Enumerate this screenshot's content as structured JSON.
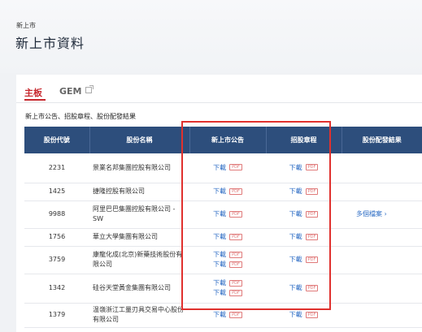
{
  "breadcrumb": "新上市",
  "page_title": "新上市資料",
  "tabs": [
    {
      "label": "主板",
      "active": true
    },
    {
      "label": "GEM",
      "active": false
    }
  ],
  "subtitle": "新上市公告、招股章程、股份配發結果",
  "table": {
    "headers": [
      "股份代號",
      "股份名稱",
      "新上市公告",
      "招股章程",
      "股份配發結果"
    ],
    "download_label": "下載",
    "pdf_label": "PDF",
    "rows": [
      {
        "code": "2231",
        "name": "景業名邦集團控股有限公司",
        "announcement_files": 1,
        "prospectus_files": 1,
        "allotment": ""
      },
      {
        "code": "1425",
        "name": "捷隆控股有限公司",
        "announcement_files": 1,
        "prospectus_files": 1,
        "allotment": ""
      },
      {
        "code": "9988",
        "name": "阿里巴巴集團控股有限公司 - SW",
        "announcement_files": 1,
        "prospectus_files": 1,
        "allotment": "多個檔案 ›"
      },
      {
        "code": "1756",
        "name": "華立大學集團有限公司",
        "announcement_files": 1,
        "prospectus_files": 1,
        "allotment": ""
      },
      {
        "code": "3759",
        "name": "康龍化成(北京)新藥技術股份有限公司",
        "announcement_files": 2,
        "prospectus_files": 1,
        "allotment": ""
      },
      {
        "code": "1342",
        "name": "硅谷天堂黃金集團有限公司",
        "announcement_files": 2,
        "prospectus_files": 1,
        "allotment": ""
      },
      {
        "code": "1379",
        "name": "温嶺浙江工量刃具交易中心股份有限公司",
        "announcement_files": 1,
        "prospectus_files": 1,
        "allotment": ""
      }
    ]
  },
  "colors": {
    "header_bg": "#2d4e7c",
    "accent_red": "#c7282e",
    "highlight_border": "#e0312e",
    "link_blue": "#2f6ec5"
  }
}
